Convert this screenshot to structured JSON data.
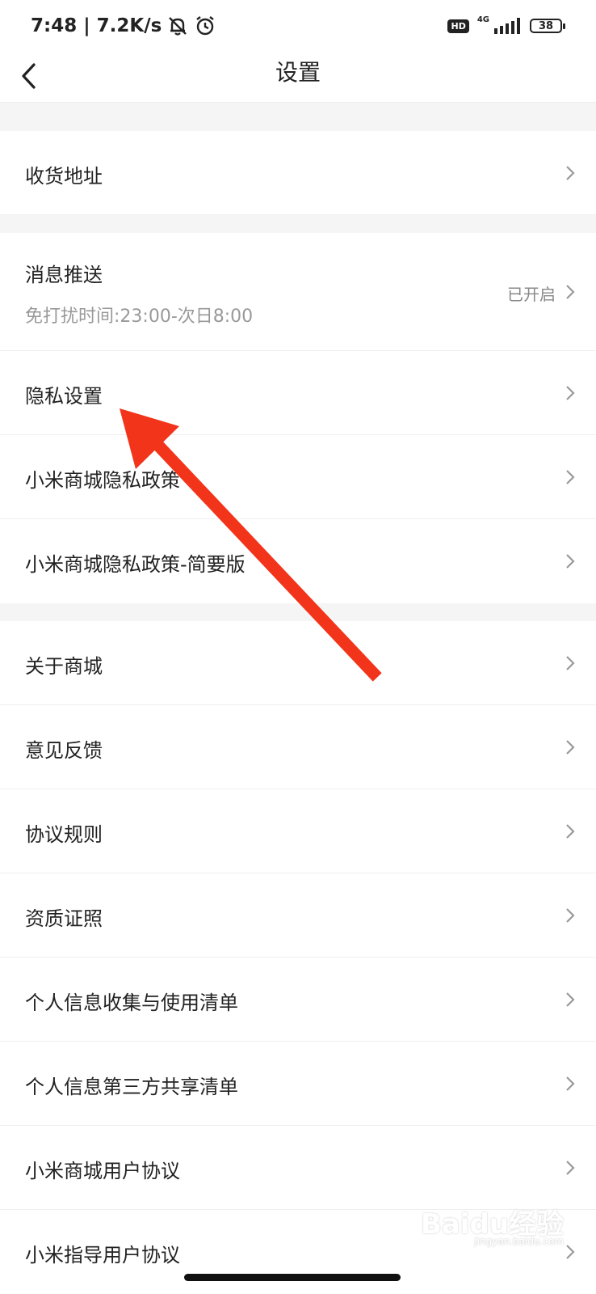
{
  "status_bar": {
    "time_speed": "7:48 | 7.2K/s",
    "hd": "HD",
    "network": "4G",
    "battery": "38"
  },
  "header": {
    "title": "设置"
  },
  "rows": {
    "address": {
      "label": "收货地址"
    },
    "push": {
      "label": "消息推送",
      "sub": "免打扰时间:23:00-次日8:00",
      "value": "已开启"
    },
    "privacy_settings": {
      "label": "隐私设置"
    },
    "privacy_policy": {
      "label": "小米商城隐私政策"
    },
    "privacy_policy_brief": {
      "label": "小米商城隐私政策-简要版"
    },
    "about": {
      "label": "关于商城"
    },
    "feedback": {
      "label": "意见反馈"
    },
    "rules": {
      "label": "协议规则"
    },
    "qualification": {
      "label": "资质证照"
    },
    "personal_info_list": {
      "label": "个人信息收集与使用清单"
    },
    "third_party_list": {
      "label": "个人信息第三方共享清单"
    },
    "user_agreement": {
      "label": "小米商城用户协议"
    },
    "partial_next": {
      "label": "小米指导用户协议"
    }
  },
  "watermark": {
    "logo": "Baidu经验",
    "url": "jingyan.baidu.com"
  },
  "colors": {
    "arrow": "#f2341b",
    "divider": "#f5f5f5"
  }
}
